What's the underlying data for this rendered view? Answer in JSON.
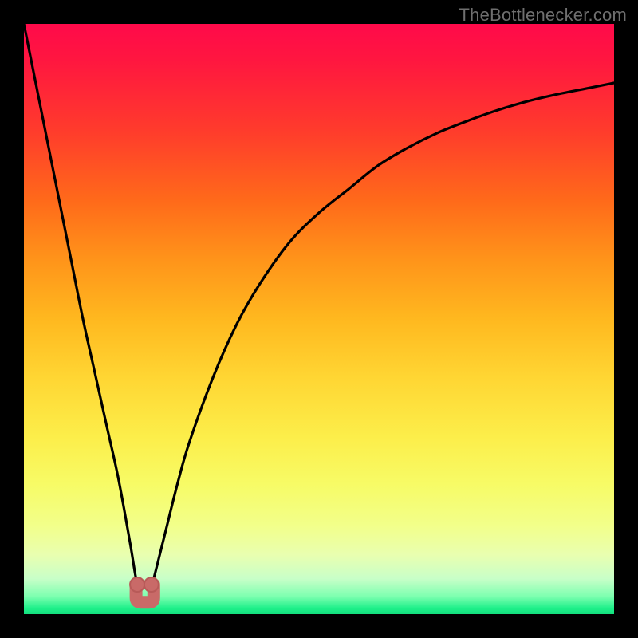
{
  "watermark": {
    "text": "TheBottlenecker.com"
  },
  "colors": {
    "frame": "#000000",
    "curve_stroke": "#000000",
    "marker_fill": "#c96a68",
    "marker_stroke": "#b85a58",
    "gradient_top": "#ff0a4a",
    "gradient_bottom": "#14e07e"
  },
  "chart_data": {
    "type": "line",
    "title": "",
    "xlabel": "",
    "ylabel": "",
    "xlim": [
      0,
      100
    ],
    "ylim": [
      0,
      100
    ],
    "grid": false,
    "legend": false,
    "annotations": [
      "TheBottlenecker.com"
    ],
    "series": [
      {
        "name": "bottleneck-curve",
        "x": [
          0,
          2,
          4,
          6,
          8,
          10,
          12,
          14,
          16,
          18,
          19,
          20,
          21,
          22,
          24,
          26,
          28,
          32,
          36,
          40,
          45,
          50,
          55,
          60,
          65,
          70,
          75,
          80,
          85,
          90,
          95,
          100
        ],
        "y": [
          100,
          90,
          80,
          70,
          60,
          50,
          41,
          32,
          23,
          12,
          6,
          2,
          2,
          6,
          14,
          22,
          29,
          40,
          49,
          56,
          63,
          68,
          72,
          76,
          79,
          81.5,
          83.5,
          85.3,
          86.8,
          88,
          89,
          90
        ]
      }
    ],
    "markers": [
      {
        "name": "left-dot",
        "x": 19.2,
        "y": 5
      },
      {
        "name": "right-dot",
        "x": 21.6,
        "y": 5
      }
    ],
    "minimum_zone": {
      "x_start": 19,
      "x_end": 22,
      "y": 2
    }
  }
}
